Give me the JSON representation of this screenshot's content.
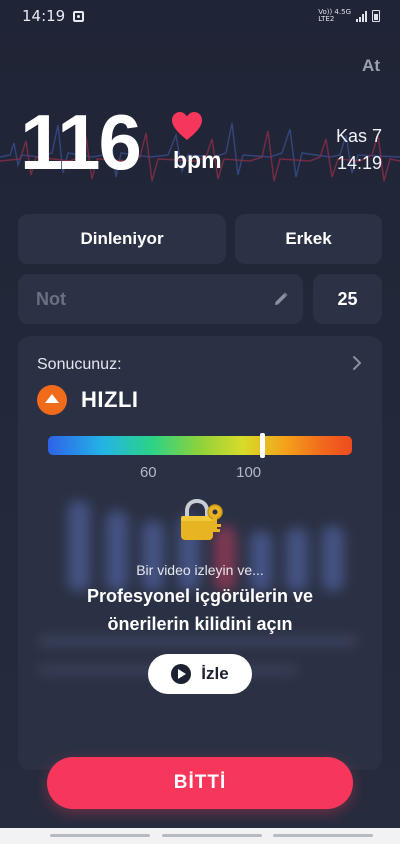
{
  "status_bar": {
    "time": "14:19",
    "network_top": "Vo)) 4.5G",
    "network_bottom": "LTE2"
  },
  "header": {
    "share_label": "At"
  },
  "measurement": {
    "bpm_value": "116",
    "bpm_unit": "bpm",
    "date": "Kas 7",
    "time": "14:19"
  },
  "tags": {
    "state": "Dinleniyor",
    "gender": "Erkek",
    "note_placeholder": "Not",
    "age": "25"
  },
  "result": {
    "label": "Sonucunuz:",
    "speed": "HIZLI",
    "speed_color": "#f06b1a",
    "scale_marker_fraction": 0.705,
    "ticks": [
      {
        "value": "60",
        "fraction": 0.33
      },
      {
        "value": "100",
        "fraction": 0.66
      }
    ]
  },
  "unlock": {
    "subtitle": "Bir video izleyin ve...",
    "title_line1": "Profesyonel içgörülerin ve",
    "title_line2": "önerilerin kilidini açın",
    "watch_label": "İzle"
  },
  "footer": {
    "done_label": "BİTTİ",
    "done_color": "#f6375b"
  },
  "colors": {
    "background": "#222839",
    "card": "#2b3144",
    "heart": "#f6375b"
  }
}
